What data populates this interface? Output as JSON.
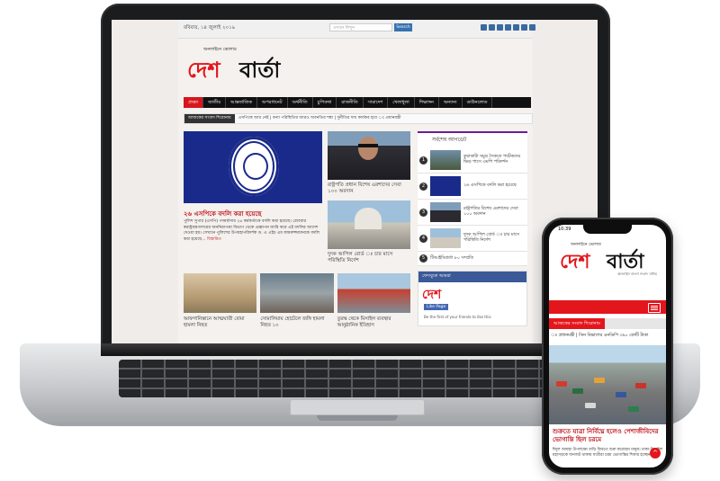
{
  "laptop": {
    "topbar": {
      "date": "রবিবার, ১৪ জুলাই ২০১৯",
      "search_placeholder": "এখানে লিখুন",
      "search_button": "Search"
    },
    "logo": {
      "tagline": "অনলাইনে ভোলার",
      "word1": "দেশ",
      "word2": "বার্তা"
    },
    "nav": [
      "প্রচ্ছদ",
      "জাতীয়",
      "আন্তর্জাতিক",
      "অপরাধনেট",
      "অর্থনীতি",
      "চুপিকথা",
      "রাজনীতি",
      "সারাদেশ",
      "খেলাধুলা",
      "শিক্ষাঙ্গন",
      "অন্যান্য",
      "ডাউনলোড"
    ],
    "ticker": {
      "label": "আজকের সংবাদ শিরোনাম",
      "text": "এসপিকে আর নেই | বন্যা পরিস্থিতির আরও অবনতির শঙ্কা | দুর্নীতির দায় কার্যকর হবে ঃ প্রধানমন্ত্রী"
    },
    "hero": {
      "title": "২৬ এসপিকে বদলি করা হয়েছে",
      "body": "পুলিশ সুপার (এসপি) পদমর্যাদার ২৬ কর্মকর্তাকে বদলি করা হয়েছে। রোববার স্বরাষ্ট্রমন্ত্রণালয়ের জননিরাপত্তা বিভাগ থেকে প্রজ্ঞাপন জারি করে এই বদলির আদেশ দেওয়া হয়। সেখানে পুলিশের উপমহাপরিদর্শক ড. এ এইচ এম কামরুজ্জামানকে বদলি করা হয়েছে...",
      "more": "বিস্তারিত"
    },
    "mid_cards": [
      {
        "caption": "রাষ্ট্রপতি প্রধান বিশেষ এরশাদের সেবা ১০০ অবদান"
      },
      {
        "caption": "দুদক আপিল বোর্ড ঃ চার মাসে পরিস্থিতি নির্দেশ"
      }
    ],
    "latest": {
      "heading": "সর্বশেষ আপডেট",
      "items": [
        {
          "num": "1",
          "text": "কুয়াকাটা সমুদ্র সৈকতে পর্যটকদের ভিড় পাসে এমপি পরিদর্শন"
        },
        {
          "num": "2",
          "text": "২৬ এসপিকে বদলি করা হয়েছে"
        },
        {
          "num": "3",
          "text": "রাষ্ট্রপতির বিশেষ এরশাদের সেবা ১০০ অবদান"
        },
        {
          "num": "4",
          "text": "দুদক আপিল বোর্ড ঃ চার মাসে পরিস্থিতি নির্দেশ"
        },
        {
          "num": "5",
          "text": "টিআইবিবার্তা ৮০ সম্প্রতি"
        }
      ]
    },
    "facebook": {
      "header": "ফেসবুকে আমরা",
      "logo": "দেশ",
      "like": "Like Page",
      "footer": "Be the first of your friends to like this"
    },
    "bottom_cards": [
      {
        "caption": "আফগানিস্তানে আত্মঘাতী বোমা হামলা নিহত"
      },
      {
        "caption": "সোমালিয়ায় হোটেলে জঙ্গি হামলা নিহত ১০"
      },
      {
        "caption": "তুরস্ক থেকে মিসাইল ব্যবস্থার আনুষ্ঠানিক ইতিহাস"
      }
    ]
  },
  "phone": {
    "time": "10:39",
    "logo": {
      "tagline": "অনলাইনে ভোলার",
      "word1": "দেশ",
      "word2": "বার্তা",
      "subtitle": "অনলাইন বাংলা সংবাদ মাধ্যম"
    },
    "ticker_label": "আজকের সংবাদ শিরোনাম",
    "ticker_text": "ঃ প্রধানমন্ত্রী | তিন বিভাগের এনডিপি ৩৯০ কোটি টাকা",
    "headline": "শুক্রতে যাত্রা নির্বিঘ্নে হলেও পেশাজীবিদের ভোগান্তি ছিল চরমে",
    "body": "ঈদুল আযহা উপলক্ষ্যে বাড়ি ফিরতে শুরু করেছেন মানুষ। ঢাকা-টাঙ্গাইল মহাসড়কে যানজট থাকায় যাত্রীরা চরম ভোগান্তির শিকার হচ্ছেন...",
    "top_button": "^"
  }
}
